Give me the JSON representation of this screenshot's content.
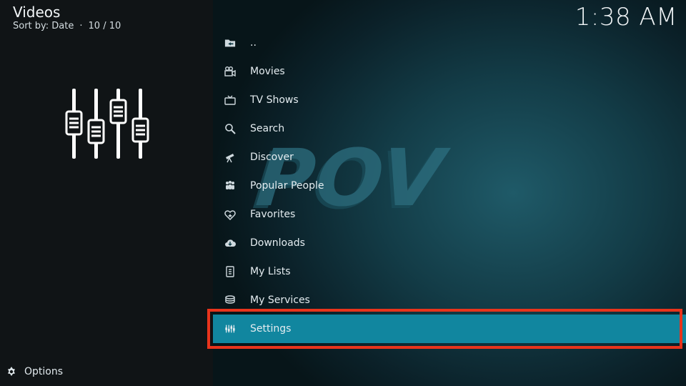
{
  "header": {
    "title": "Videos",
    "sort_label": "Sort by: Date",
    "count": "10 / 10"
  },
  "clock": "1:38 AM",
  "watermark": "POV",
  "menu": [
    {
      "label": "..",
      "icon": "folder-back-icon"
    },
    {
      "label": "Movies",
      "icon": "movie-camera-icon"
    },
    {
      "label": "TV Shows",
      "icon": "tv-icon"
    },
    {
      "label": "Search",
      "icon": "search-icon"
    },
    {
      "label": "Discover",
      "icon": "telescope-icon"
    },
    {
      "label": "Popular People",
      "icon": "people-icon"
    },
    {
      "label": "Favorites",
      "icon": "heart-icon"
    },
    {
      "label": "Downloads",
      "icon": "cloud-download-icon"
    },
    {
      "label": "My Lists",
      "icon": "list-icon"
    },
    {
      "label": "My Services",
      "icon": "stack-icon"
    },
    {
      "label": "Settings",
      "icon": "sliders-icon"
    }
  ],
  "selected_index": 10,
  "footer": {
    "options_label": "Options"
  },
  "colors": {
    "selected": "#11869f",
    "highlight_border": "#e8341c"
  }
}
